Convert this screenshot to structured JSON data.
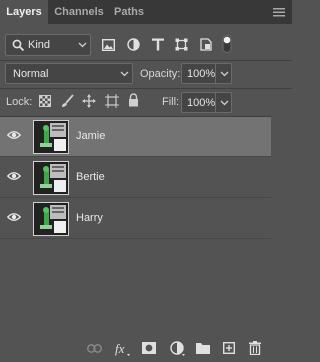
{
  "tabs": [
    {
      "label": "Layers",
      "active": true
    },
    {
      "label": "Channels",
      "active": false
    },
    {
      "label": "Paths",
      "active": false
    }
  ],
  "filter": {
    "kind_value": "Kind",
    "filter_icons": [
      "image-filter-icon",
      "adjustment-filter-icon",
      "type-filter-icon",
      "shape-filter-icon",
      "smart-object-filter-icon",
      "filter-toggle-icon"
    ]
  },
  "blend": {
    "mode_value": "Normal",
    "opacity_label": "Opacity:",
    "opacity_value": "100%"
  },
  "lock": {
    "label": "Lock:",
    "fill_label": "Fill:",
    "fill_value": "100%"
  },
  "layers": [
    {
      "name": "Jamie",
      "visible": true,
      "selected": true
    },
    {
      "name": "Bertie",
      "visible": true,
      "selected": false
    },
    {
      "name": "Harry",
      "visible": true,
      "selected": false
    }
  ],
  "footer_icons": [
    "link-layers-icon",
    "fx-icon",
    "add-mask-icon",
    "adjustment-layer-icon",
    "new-group-icon",
    "new-layer-icon",
    "delete-layer-icon"
  ],
  "colors": {
    "panel_bg": "#535353",
    "tab_bar_bg": "#383838",
    "selected_row": "#737373",
    "field_bg": "#454545"
  }
}
